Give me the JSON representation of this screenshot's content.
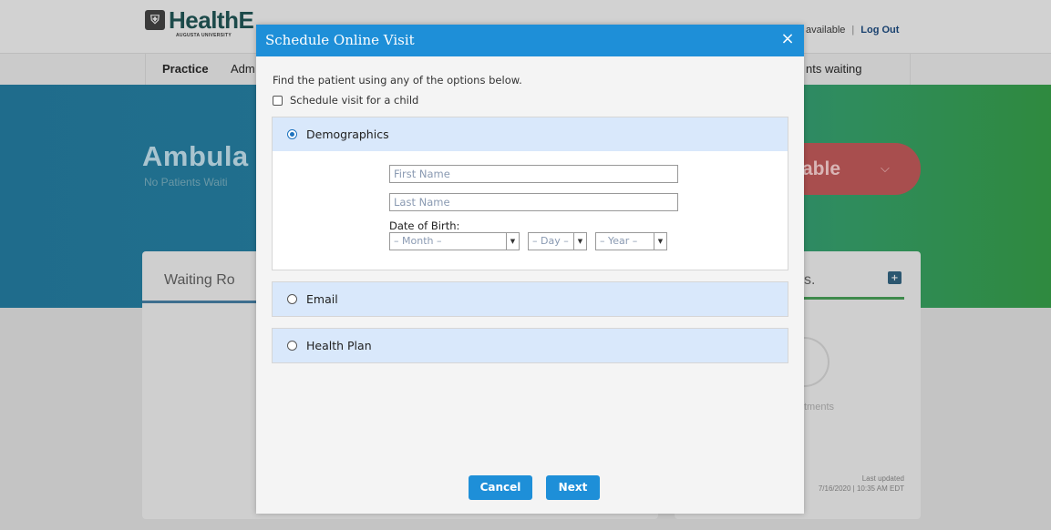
{
  "background": {
    "logo": {
      "text": "HealthE",
      "sub": "AUGUSTA UNIVERSITY"
    },
    "top_right": {
      "status": "available",
      "separator": "|",
      "logout": "Log Out"
    },
    "nav": {
      "practice": "Practice",
      "admin": "Adm",
      "patients_waiting": "nts waiting"
    },
    "hero": {
      "title": "Ambula",
      "subtitle": "No Patients Waiti",
      "availability": "able"
    },
    "waiting_card": {
      "title": "Waiting Ro"
    },
    "appointments_card": {
      "title": "s.",
      "empty_text": "tments",
      "last_updated_label": "Last updated",
      "last_updated_value": "7/16/2020 | 10:35 AM EDT"
    }
  },
  "modal": {
    "title": "Schedule Online Visit",
    "close_glyph": "×",
    "instructions": "Find the patient using any of the options below.",
    "child_checkbox": {
      "label": "Schedule visit for a child",
      "checked": false
    },
    "options": {
      "demographics": {
        "label": "Demographics",
        "selected": true,
        "first_name_placeholder": "First Name",
        "last_name_placeholder": "Last Name",
        "dob_label": "Date of Birth:",
        "month": "– Month –",
        "day": "– Day –",
        "year": "– Year –"
      },
      "email": {
        "label": "Email",
        "selected": false
      },
      "health_plan": {
        "label": "Health Plan",
        "selected": false
      }
    },
    "buttons": {
      "cancel": "Cancel",
      "next": "Next"
    }
  },
  "colors": {
    "modal_header": "#1e8fd8",
    "panel_header": "#d9e8fb",
    "button": "#1e8fd8"
  }
}
